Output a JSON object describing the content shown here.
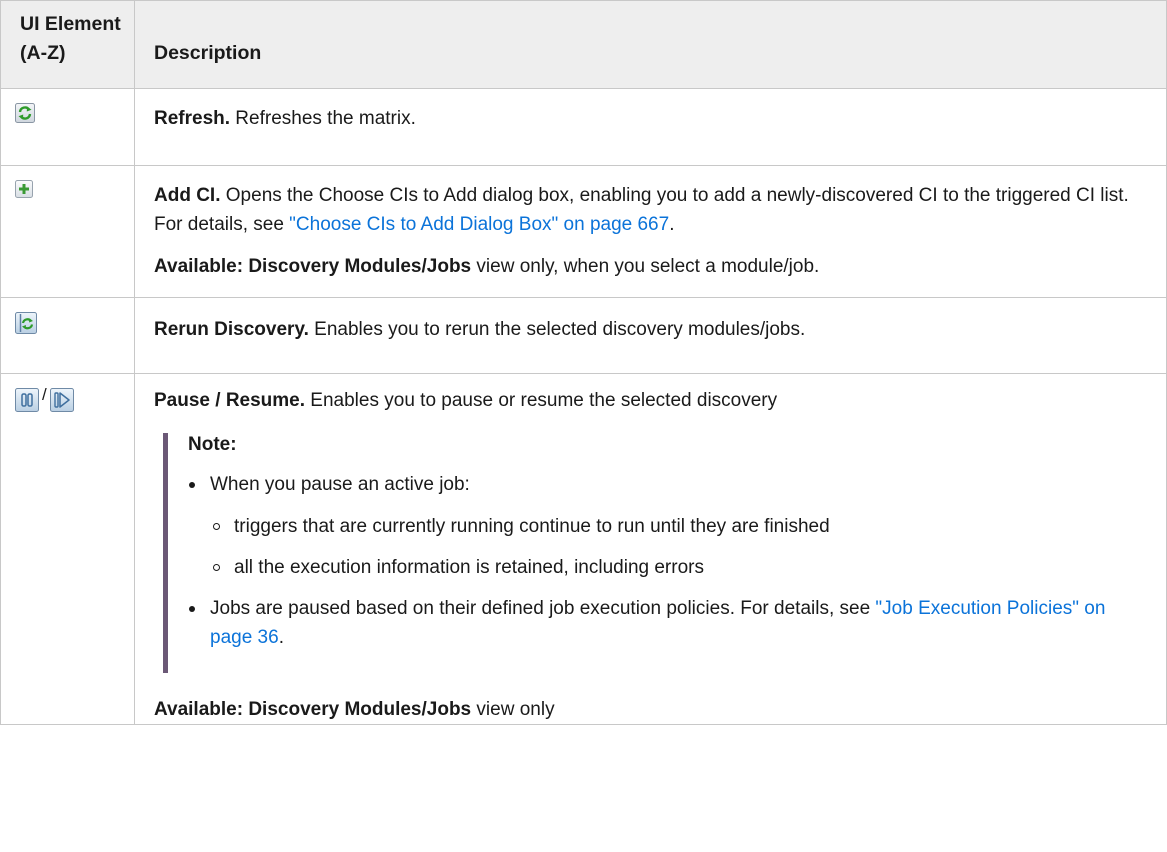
{
  "table": {
    "headers": {
      "element": "UI Element (A-Z)",
      "description": "Description"
    },
    "rows": [
      {
        "icon": "refresh-icon",
        "title": "Refresh.",
        "text": " Refreshes the matrix."
      },
      {
        "icon": "add-ci-icon",
        "title": "Add CI.",
        "text_before_link": " Opens the Choose CIs to Add dialog box, enabling you to add a newly-discovered CI to the triggered CI list. For details, see ",
        "link": "\"Choose CIs to Add Dialog Box\" on page 667",
        "text_after_link": ".",
        "avail_label": "Available: Discovery Modules/Jobs",
        "avail_text": " view only, when you select a module/job."
      },
      {
        "icon": "rerun-discovery-icon",
        "title": "Rerun Discovery.",
        "text": " Enables you to rerun the selected discovery modules/jobs."
      },
      {
        "icons": [
          "pause-icon",
          "resume-icon"
        ],
        "icon_separator": "/",
        "title": "Pause / Resume.",
        "text": " Enables you to pause or resume the selected discovery",
        "note_title": "Note:",
        "bullet1": "When you pause an active job:",
        "sub_bullets": [
          "triggers that are currently running continue to run until they are finished",
          "all the execution information is retained, including errors"
        ],
        "bullet2_text": "Jobs are paused based on their defined job execution policies. For details, see ",
        "bullet2_link": "\"Job Execution Policies\" on page 36",
        "bullet2_after": ".",
        "avail_label": "Available: Discovery Modules/Jobs",
        "avail_text": " view only"
      }
    ]
  },
  "colors": {
    "header_bg": "#eeeeee",
    "border": "#c8c8c8",
    "link": "#0b73d9",
    "note_bar": "#6b5876"
  }
}
